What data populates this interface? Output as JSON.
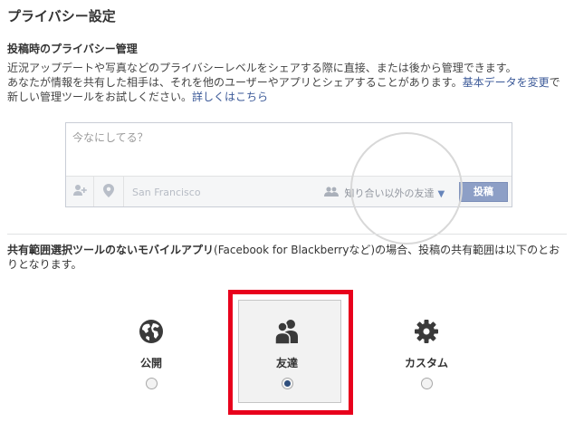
{
  "page": {
    "title": "プライバシー設定"
  },
  "posting": {
    "heading": "投稿時のプライバシー管理",
    "desc_1": "近況アップデートや写真などのプライバシーレベルをシェアする際に直接、または後から管理できます。",
    "desc_2": "あなたが情報を共有した相手は、それを他のユーザーやアプリとシェアすることがあります。",
    "link_basic": "基本データを変更",
    "desc_3": "で新しい管理ツールをお試しください。",
    "link_more": "詳しくはこちら"
  },
  "composer": {
    "placeholder": "今なにしてる？",
    "location": "San Francisco",
    "audience": "知り合い以外の友達",
    "post_button": "投稿"
  },
  "mobile": {
    "bold": "共有範囲選択ツールのないモバイルアプリ",
    "rest": "(Facebook for Blackberryなど)の場合、投稿の共有範囲は以下のとおりとなります。"
  },
  "options": [
    {
      "label": "公開",
      "icon": "globe-icon",
      "selected": false
    },
    {
      "label": "友達",
      "icon": "friends-icon",
      "selected": true
    },
    {
      "label": "カスタム",
      "icon": "gear-icon",
      "selected": false
    }
  ],
  "colors": {
    "link": "#3b5998",
    "highlight": "#e8001c",
    "post_button": "#8d9fc6"
  }
}
